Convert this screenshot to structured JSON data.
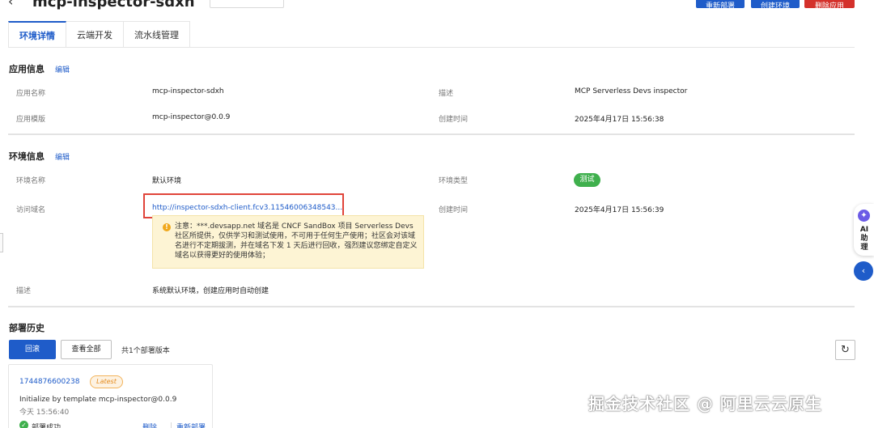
{
  "header": {
    "back_icon": "chevron-left-icon",
    "app_name": "mcp-inspector-sdxh",
    "input_placeholder": "",
    "buttons": [
      "重新部署",
      "创建环境",
      "删除应用"
    ]
  },
  "tabs": [
    "环境详情",
    "云端开发",
    "流水线管理"
  ],
  "app_info": {
    "title": "应用信息",
    "edit": "编辑",
    "name_label": "应用名称",
    "name": "mcp-inspector-sdxh",
    "template_label": "应用模版",
    "template": "mcp-inspector@0.0.9",
    "desc_label": "描述",
    "desc": "MCP Serverless Devs inspector",
    "created_label": "创建时间",
    "created": "2025年4月17日 15:56:38"
  },
  "env_info": {
    "title": "环境信息",
    "edit": "编辑",
    "name_label": "环境名称",
    "name": "默认环境",
    "type_label": "环境类型",
    "type": "测试",
    "domain_label": "访问域名",
    "domain": "http://inspector-sdxh-client.fcv3.11546006348543...",
    "created_label": "创建时间",
    "created": "2025年4月17日 15:56:39",
    "notice": "注意：***.devsapp.net 域名是 CNCF SandBox 项目 Serverless Devs 社区所提供，仅供学习和测试使用，不可用于任何生产使用；社区会对该域名进行不定期拔测，并在域名下发 1 天后进行回收，强烈建议您绑定自定义域名以获得更好的使用体验；",
    "desc_label": "描述",
    "desc": "系统默认环境，创建应用时自动创建"
  },
  "deploy": {
    "title": "部署历史",
    "rollback": "回滚",
    "view_all": "查看全部",
    "count_text": "共1个部署版本",
    "card": {
      "id": "1744876600238",
      "tag": "Latest",
      "desc": "Initialize by template mcp-inspector@0.0.9",
      "time": "今天 15:56:40",
      "status": "部署成功",
      "delete": "删除",
      "redeploy": "重新部署"
    }
  },
  "ai_assistant": {
    "label": "AI助理"
  },
  "watermark": "掘金技术社区 @ 阿里云云原生",
  "colors": {
    "primary": "#1f5cc9",
    "danger": "#d4312b",
    "success": "#3fb04d",
    "warning_bg": "#fdf4d4",
    "highlight_box": "#e0443a"
  }
}
